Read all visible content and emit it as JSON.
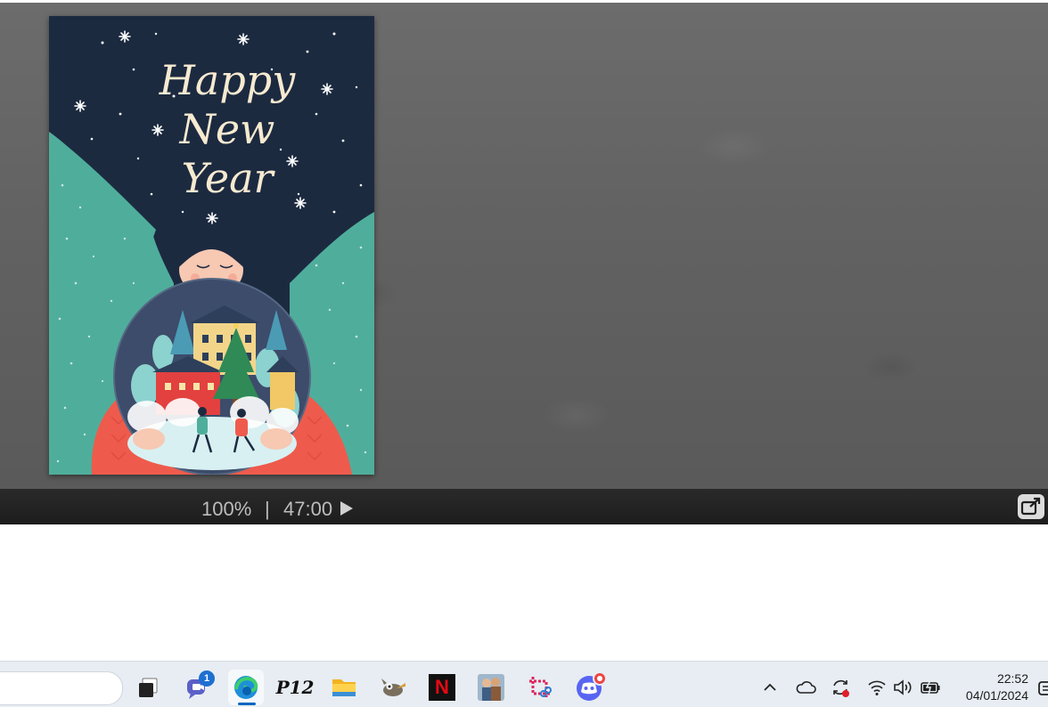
{
  "slide": {
    "greeting_lines": [
      "Happy",
      "New",
      "Year"
    ]
  },
  "statusbar": {
    "zoom": "100%",
    "separator": "|",
    "timer": "47:00"
  },
  "taskbar": {
    "chat_badge": "1",
    "p12_label": "P12",
    "netflix_label": "N",
    "clock_time": "22:52",
    "clock_date": "04/01/2024"
  },
  "colors": {
    "slide_navy": "#1c2a40",
    "slide_teal": "#4fae9b",
    "sweater_red": "#ee5b4c",
    "taskbar_bg": "#e7edf3",
    "accent_blue": "#0067c0"
  }
}
